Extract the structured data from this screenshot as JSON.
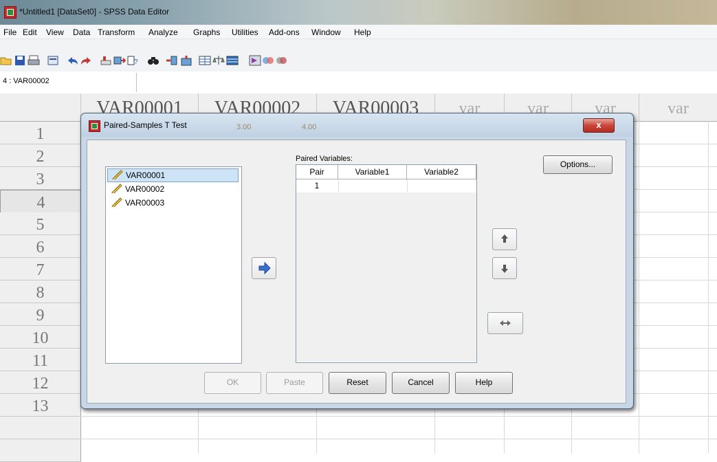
{
  "window": {
    "title": "*Untitled1 [DataSet0] - SPSS Data Editor"
  },
  "menu": [
    "File",
    "Edit",
    "View",
    "Data",
    "Transform",
    "Analyze",
    "Graphs",
    "Utilities",
    "Add-ons",
    "Window",
    "Help"
  ],
  "cell_ref": "4 : VAR00002",
  "grid": {
    "columns": [
      "VAR00001",
      "VAR00002",
      "VAR00003",
      "var",
      "var",
      "var",
      "var"
    ],
    "rows": [
      "1",
      "2",
      "3",
      "4",
      "5",
      "6",
      "7",
      "8",
      "9",
      "10",
      "11",
      "12",
      "13"
    ],
    "row1_values": [
      "3.00",
      "4.00"
    ]
  },
  "dialog": {
    "title": "Paired-Samples T Test",
    "close_label": "x",
    "variables": [
      "VAR00001",
      "VAR00002",
      "VAR00003"
    ],
    "selected_variable": "VAR00001",
    "paired_label": "Paired Variables:",
    "table_headers": [
      "Pair",
      "Variable1",
      "Variable2"
    ],
    "pairs": [
      {
        "pair": "1",
        "variable1": "",
        "variable2": ""
      }
    ],
    "buttons": {
      "options": "Options...",
      "ok": "OK",
      "paste": "Paste",
      "reset": "Reset",
      "cancel": "Cancel",
      "help": "Help"
    }
  }
}
